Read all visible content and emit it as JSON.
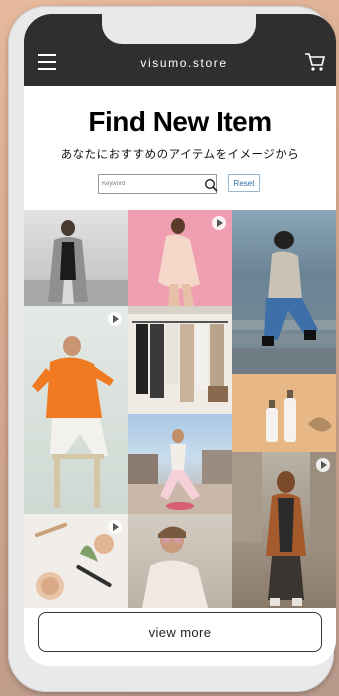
{
  "header": {
    "brand": "visumo.store",
    "menu_icon": "hamburger-menu-icon",
    "cart_icon": "cart-icon"
  },
  "main": {
    "title": "Find New Item",
    "subtitle": "あなたにおすすめのアイテムをイメージから"
  },
  "search": {
    "placeholder": "Keyword",
    "icon": "search-icon",
    "reset_label": "Reset"
  },
  "gallery": {
    "tiles": [
      {
        "name": "gallery-item-plaid-coat-woman",
        "video": false
      },
      {
        "name": "gallery-item-pink-dress-woman",
        "video": true
      },
      {
        "name": "gallery-item-denim-stairs-woman",
        "video": false
      },
      {
        "name": "gallery-item-clothing-rack",
        "video": false
      },
      {
        "name": "gallery-item-orange-hoodie-woman",
        "video": true
      },
      {
        "name": "gallery-item-cosmetic-bottles",
        "video": false
      },
      {
        "name": "gallery-item-rooftop-pose-woman",
        "video": false
      },
      {
        "name": "gallery-item-street-coat-woman",
        "video": true
      },
      {
        "name": "gallery-item-makeup-flatlay",
        "video": true
      },
      {
        "name": "gallery-item-sunglasses-woman",
        "video": false
      }
    ]
  },
  "footer": {
    "view_more_label": "view more"
  }
}
